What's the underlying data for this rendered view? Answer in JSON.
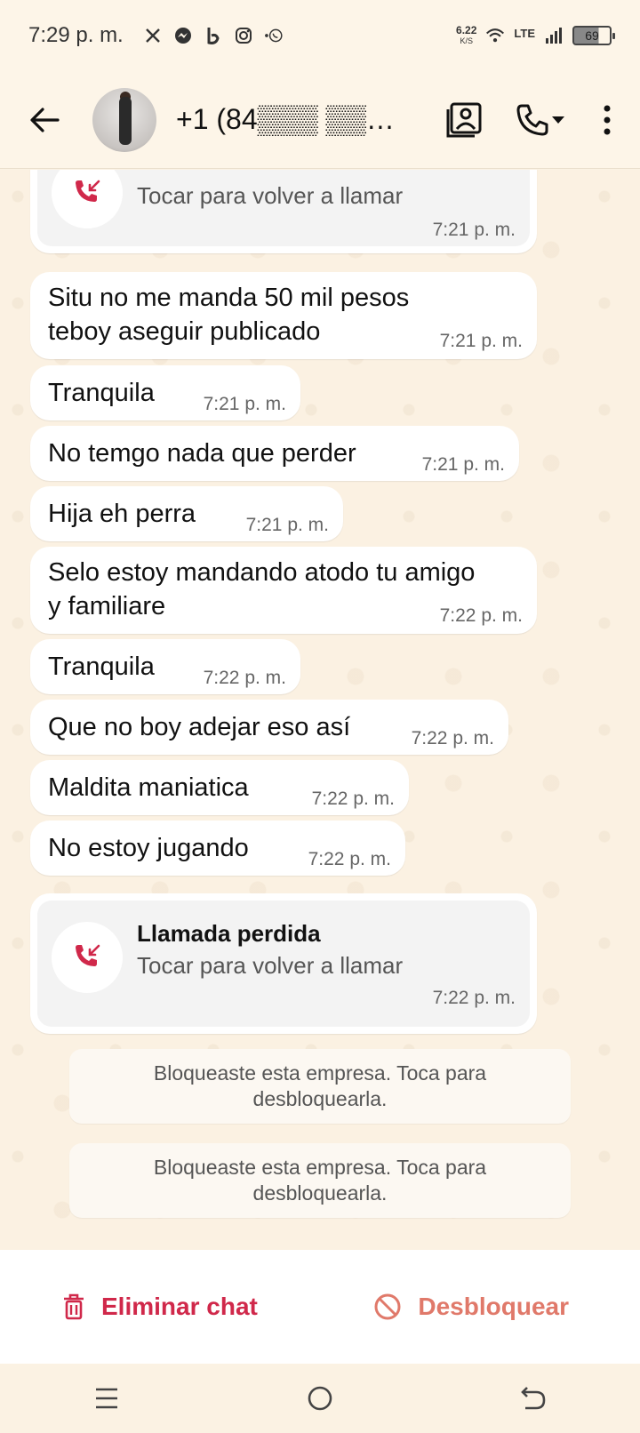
{
  "status_bar": {
    "time": "7:29 p. m.",
    "net_speed": "6.22",
    "net_unit": "K/S",
    "network": "LTE",
    "battery": "69",
    "icons": [
      "x-icon",
      "messenger-icon",
      "bold-b-icon",
      "instagram-icon",
      "whatsapp-icon",
      "wifi-icon",
      "signal-icon",
      "battery-icon"
    ]
  },
  "header": {
    "contact_name": "+1 (84▒▒▒ ▒▒▒▒)-5...",
    "icons": [
      "back-arrow-icon",
      "contact-card-icon",
      "phone-icon",
      "dropdown-icon",
      "more-vertical-icon"
    ]
  },
  "chat": {
    "top_call": {
      "subtitle": "Tocar para volver a llamar",
      "time": "7:21 p. m."
    },
    "messages": [
      {
        "text": "Situ no me manda 50 mil pesos\nteboy aseguir publicado",
        "time": "7:21 p. m."
      },
      {
        "text": "Tranquila",
        "time": "7:21 p. m."
      },
      {
        "text": "No temgo nada que perder",
        "time": "7:21 p. m."
      },
      {
        "text": "Hija eh perra",
        "time": "7:21 p. m."
      },
      {
        "text": "Selo estoy mandando atodo tu amigo\ny familiare",
        "time": "7:22 p. m."
      },
      {
        "text": "Tranquila",
        "time": "7:22 p. m."
      },
      {
        "text": "Que no boy adejar eso así",
        "time": "7:22 p. m."
      },
      {
        "text": "Maldita maniatica",
        "time": "7:22 p. m."
      },
      {
        "text": "No estoy jugando",
        "time": "7:22 p. m."
      }
    ],
    "missed_call": {
      "title": "Llamada perdida",
      "subtitle": "Tocar para volver a llamar",
      "time": "7:22 p. m."
    },
    "system_messages": [
      "Bloqueaste esta empresa. Toca para\ndesbloquearla.",
      "Bloqueaste esta empresa. Toca para\ndesbloquearla."
    ]
  },
  "actions": {
    "delete_label": "Eliminar chat",
    "unblock_label": "Desbloquear",
    "colors": {
      "delete": "#d0284a",
      "unblock": "#e0796a"
    }
  },
  "nav": {
    "icons": [
      "menu-icon",
      "home-circle-icon",
      "back-icon"
    ]
  }
}
